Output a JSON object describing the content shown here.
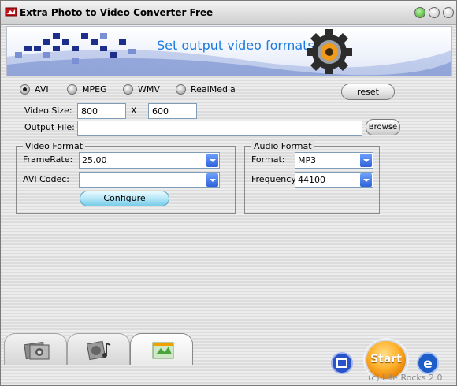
{
  "window": {
    "title": "Extra Photo to Video Converter Free"
  },
  "banner": {
    "text": "Set output video formats"
  },
  "formats": [
    {
      "label": "AVI",
      "selected": true
    },
    {
      "label": "MPEG",
      "selected": false
    },
    {
      "label": "WMV",
      "selected": false
    },
    {
      "label": "RealMedia",
      "selected": false
    }
  ],
  "buttons": {
    "reset": "reset",
    "browse": "Browse",
    "configure": "Configure",
    "start": "Start"
  },
  "video_size": {
    "label": "Video Size:",
    "width": "800",
    "separator": "X",
    "height": "600"
  },
  "output_file": {
    "label": "Output File:",
    "value": ""
  },
  "video_format": {
    "legend": "Video Format",
    "framerate_label": "FrameRate:",
    "framerate_value": "25.00",
    "codec_label": "AVI Codec:",
    "codec_value": ""
  },
  "audio_format": {
    "legend": "Audio  Format",
    "format_label": "Format:",
    "format_value": "MP3",
    "frequency_label": "Frequency",
    "frequency_value": "44100"
  },
  "footer": {
    "credit": "(c) Life Rocks 2.0"
  },
  "colors": {
    "banner_text": "#1b7be0",
    "combo_arrow": "#2f63d8",
    "start_button": "#ffb02a",
    "configure_button": "#79cce8"
  },
  "icons": [
    "app-icon",
    "gear-icon",
    "photo-tab-icon",
    "music-tab-icon",
    "video-tab-icon",
    "film-icon",
    "ie-icon"
  ]
}
